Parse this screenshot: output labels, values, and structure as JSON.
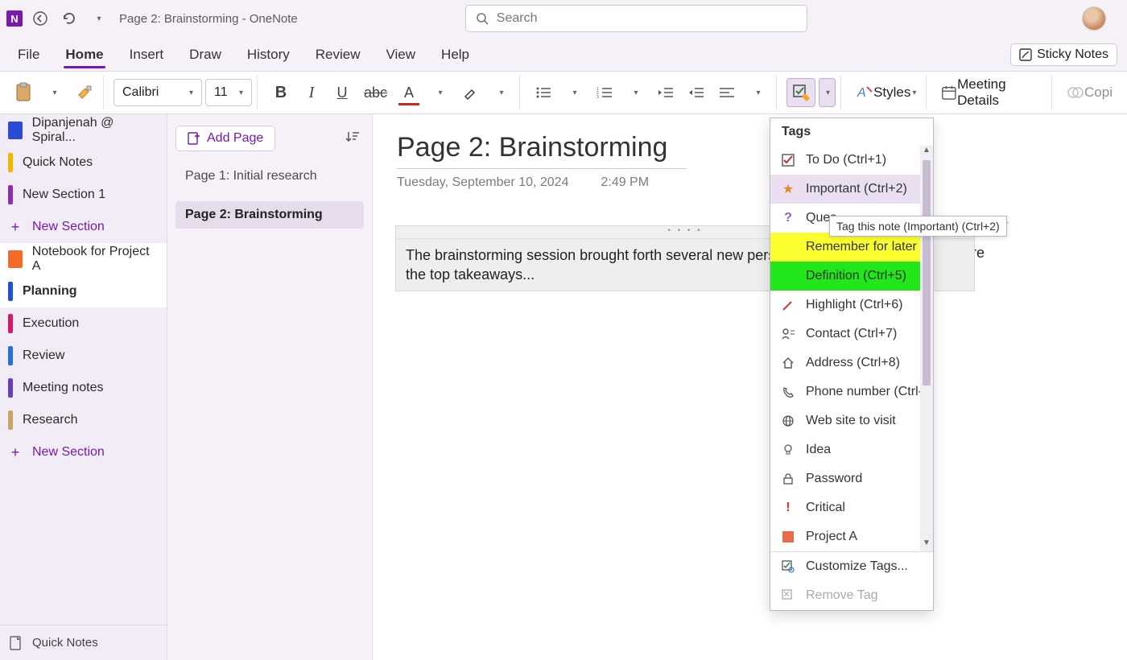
{
  "title": "Page 2: Brainstorming  -  OneNote",
  "app_letter": "N",
  "search_placeholder": "Search",
  "tabs": [
    "File",
    "Home",
    "Insert",
    "Draw",
    "History",
    "Review",
    "View",
    "Help"
  ],
  "active_tab_index": 1,
  "sticky_notes_label": "Sticky Notes",
  "ribbon": {
    "font_name": "Calibri",
    "font_size": "11",
    "styles_label": "Styles",
    "meeting_label": "Meeting Details",
    "copilot_label": "Copi"
  },
  "nav": {
    "account": "Dipanjenah @ Spiral...",
    "items": [
      {
        "label": "Quick Notes",
        "color": "#f2b600"
      },
      {
        "label": "New Section 1",
        "color": "#8e2fb0"
      }
    ],
    "new_section": "New Section",
    "notebook": "Notebook for Project A",
    "sections": [
      {
        "label": "Planning",
        "color": "#2352c9",
        "active": true
      },
      {
        "label": "Execution",
        "color": "#d11a6a"
      },
      {
        "label": "Review",
        "color": "#2a6fd6"
      },
      {
        "label": "Meeting notes",
        "color": "#6a40b5"
      },
      {
        "label": "Research",
        "color": "#c9a36a"
      }
    ],
    "new_section2": "New Section",
    "footer_quick": "Quick Notes"
  },
  "pagelist": {
    "add_label": "Add Page",
    "pages": [
      {
        "label": "Page 1: Initial research"
      },
      {
        "label": "Page 2: Brainstorming",
        "selected": true
      }
    ]
  },
  "page": {
    "title": "Page 2: Brainstorming",
    "date": "Tuesday, September 10, 2024",
    "time": "2:49 PM",
    "note_text": "The brainstorming session brought forth several new pers\nthe top takeaways...",
    "behind_text": "Here are"
  },
  "tags_panel": {
    "header": "Tags",
    "items": [
      {
        "label": "To Do (Ctrl+1)",
        "icon": "checkbox"
      },
      {
        "label": "Important (Ctrl+2)",
        "icon": "star",
        "hover": true
      },
      {
        "label": "Ques",
        "icon": "question"
      },
      {
        "label": "Remember for later",
        "icon": "",
        "style": "yellow"
      },
      {
        "label": "Definition (Ctrl+5)",
        "icon": "",
        "style": "green"
      },
      {
        "label": "Highlight (Ctrl+6)",
        "icon": "pen"
      },
      {
        "label": "Contact (Ctrl+7)",
        "icon": "contact"
      },
      {
        "label": "Address (Ctrl+8)",
        "icon": "home"
      },
      {
        "label": "Phone number (Ctrl-",
        "icon": "phone"
      },
      {
        "label": "Web site to visit",
        "icon": "web"
      },
      {
        "label": "Idea",
        "icon": "bulb"
      },
      {
        "label": "Password",
        "icon": "lock"
      },
      {
        "label": "Critical",
        "icon": "bang"
      },
      {
        "label": "Project A",
        "icon": "square"
      }
    ],
    "customize": "Customize Tags...",
    "remove": "Remove Tag"
  },
  "tooltip": "Tag this note (Important) (Ctrl+2)"
}
